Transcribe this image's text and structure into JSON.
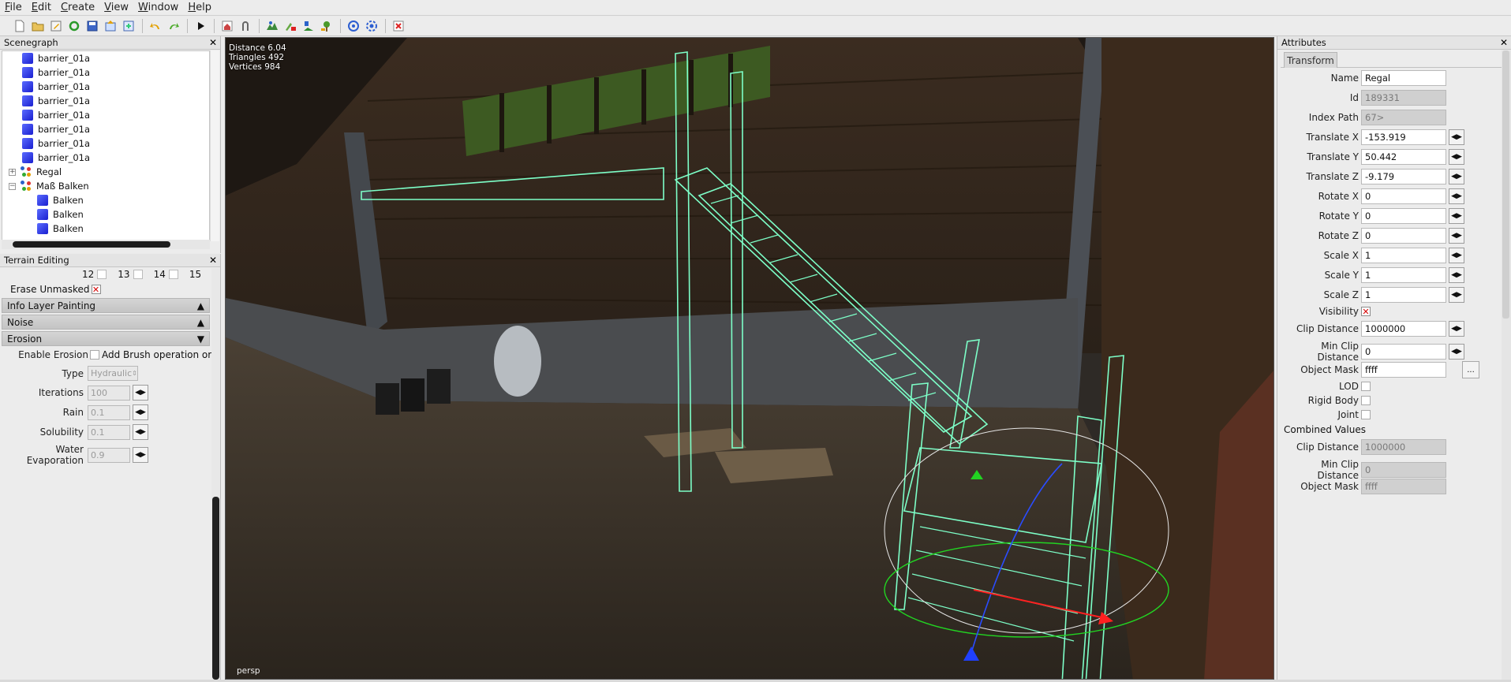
{
  "menu": [
    "File",
    "Edit",
    "Create",
    "View",
    "Window",
    "Help"
  ],
  "toolbar_icons": [
    "new-file-icon",
    "open-icon",
    "edit-icon",
    "refresh-icon",
    "save-icon",
    "export-icon",
    "import-icon",
    "undo-icon",
    "redo-icon",
    "play-icon",
    "home-icon",
    "magnet-icon",
    "terrain-icon",
    "paint-icon",
    "foliage-icon",
    "placement-icon",
    "gizmo-icon",
    "settings-icon",
    "delete-icon"
  ],
  "scenegraph": {
    "title": "Scenegraph",
    "items": [
      {
        "label": "barrier_01a",
        "indent": 1,
        "icon": "cube"
      },
      {
        "label": "barrier_01a",
        "indent": 1,
        "icon": "cube"
      },
      {
        "label": "barrier_01a",
        "indent": 1,
        "icon": "cube"
      },
      {
        "label": "barrier_01a",
        "indent": 1,
        "icon": "cube"
      },
      {
        "label": "barrier_01a",
        "indent": 1,
        "icon": "cube"
      },
      {
        "label": "barrier_01a",
        "indent": 1,
        "icon": "cube"
      },
      {
        "label": "barrier_01a",
        "indent": 1,
        "icon": "cube"
      },
      {
        "label": "barrier_01a",
        "indent": 1,
        "icon": "cube"
      },
      {
        "label": "Regal",
        "indent": 0,
        "icon": "group",
        "expander": "+"
      },
      {
        "label": "Maß Balken",
        "indent": 0,
        "icon": "group",
        "expander": "−"
      },
      {
        "label": "Balken",
        "indent": 2,
        "icon": "cube"
      },
      {
        "label": "Balken",
        "indent": 2,
        "icon": "cube"
      },
      {
        "label": "Balken",
        "indent": 2,
        "icon": "cube"
      }
    ]
  },
  "terrain": {
    "title": "Terrain Editing",
    "channels": [
      "12",
      "13",
      "14",
      "15"
    ],
    "erase_unmasked_label": "Erase Unmasked",
    "sections": {
      "info_layer": "Info Layer Painting",
      "noise": "Noise",
      "erosion": "Erosion"
    },
    "enable_erosion_label": "Enable Erosion",
    "add_brush_label": "Add Brush operation or",
    "type_label": "Type",
    "type_value": "Hydraulic",
    "iterations_label": "Iterations",
    "iterations_value": "100",
    "rain_label": "Rain",
    "rain_value": "0.1",
    "solubility_label": "Solubility",
    "solubility_value": "0.1",
    "water_evap_label": "Water Evaporation",
    "water_evap_value": "0.9"
  },
  "viewport": {
    "distance": "Distance 6.04",
    "triangles": "Triangles 492",
    "vertices": "Vertices 984",
    "camera": "persp"
  },
  "attributes": {
    "title": "Attributes",
    "tab": "Transform",
    "name_label": "Name",
    "name": "Regal",
    "id_label": "Id",
    "id": "189331",
    "index_path_label": "Index Path",
    "index_path": "67>",
    "tx_label": "Translate X",
    "tx": "-153.919",
    "ty_label": "Translate Y",
    "ty": "50.442",
    "tz_label": "Translate Z",
    "tz": "-9.179",
    "rx_label": "Rotate X",
    "rx": "0",
    "ry_label": "Rotate Y",
    "ry": "0",
    "rz_label": "Rotate Z",
    "rz": "0",
    "sx_label": "Scale X",
    "sx": "1",
    "sy_label": "Scale Y",
    "sy": "1",
    "sz_label": "Scale Z",
    "sz": "1",
    "visibility_label": "Visibility",
    "clip_label": "Clip Distance",
    "clip": "1000000",
    "minclip_label": "Min Clip Distance",
    "minclip": "0",
    "mask_label": "Object Mask",
    "mask": "ffff",
    "mask_button": "...",
    "lod_label": "LOD",
    "rigid_label": "Rigid Body",
    "joint_label": "Joint",
    "combined_label": "Combined Values",
    "c_clip_label": "Clip Distance",
    "c_clip": "1000000",
    "c_minclip_label": "Min Clip Distance",
    "c_minclip": "0",
    "c_mask_label": "Object Mask",
    "c_mask": "ffff"
  }
}
